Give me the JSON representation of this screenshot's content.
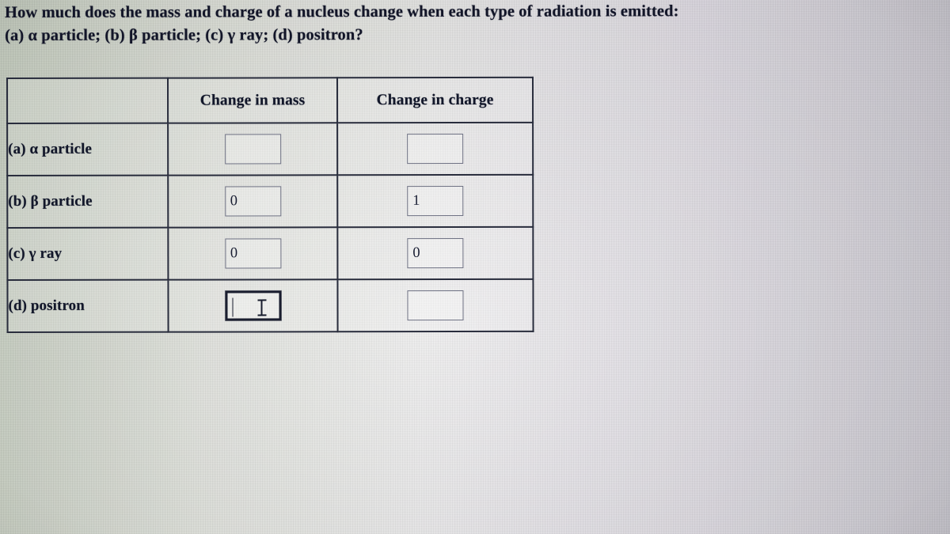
{
  "question": {
    "line1": "How much does the mass and charge of a nucleus change when each type of radiation is emitted:",
    "line2": "(a) α particle; (b) β particle; (c) γ ray; (d) positron?"
  },
  "table": {
    "headers": {
      "corner": "",
      "mass": "Change in mass",
      "charge": "Change in charge"
    },
    "rows": [
      {
        "label": "(a) α particle",
        "mass": {
          "value": "",
          "focused": false
        },
        "charge": {
          "value": "",
          "focused": false
        }
      },
      {
        "label": "(b) β particle",
        "mass": {
          "value": "0",
          "focused": false
        },
        "charge": {
          "value": "1",
          "focused": false
        }
      },
      {
        "label": "(c) γ ray",
        "mass": {
          "value": "0",
          "focused": false
        },
        "charge": {
          "value": "0",
          "focused": false
        }
      },
      {
        "label": "(d) positron",
        "mass": {
          "value": "",
          "focused": true
        },
        "charge": {
          "value": "",
          "focused": false
        }
      }
    ]
  },
  "cursor": {
    "type": "i-beam-text-cursor",
    "over": "row-d-change-in-mass-input"
  },
  "colors": {
    "page_background": "#d8d9d5",
    "text": "#15182c",
    "table_border": "#2a2e3f",
    "input_border": "#6e7184",
    "input_focus_border": "#1d2133"
  }
}
